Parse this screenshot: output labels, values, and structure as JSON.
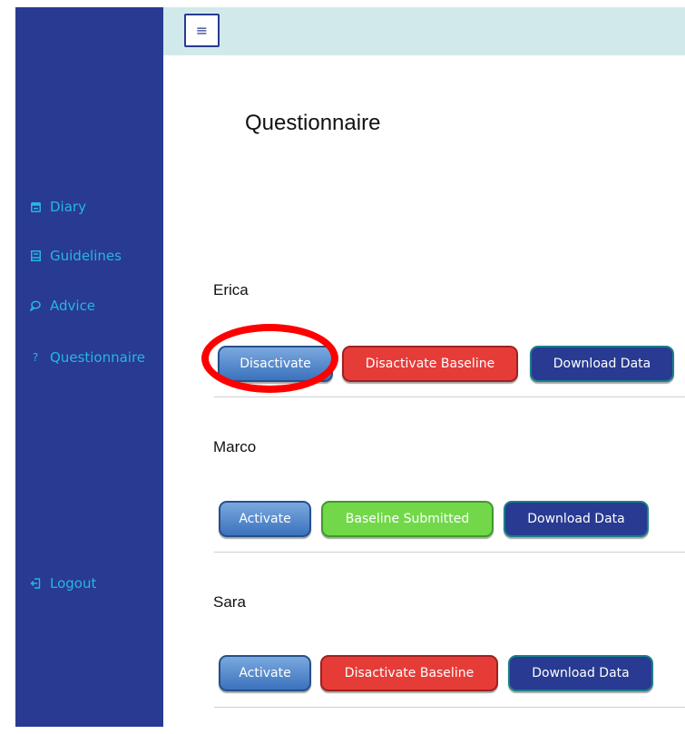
{
  "sidebar": {
    "items": [
      {
        "label": "Diary",
        "icon": "calendar-icon"
      },
      {
        "label": "Guidelines",
        "icon": "book-icon"
      },
      {
        "label": "Advice",
        "icon": "speech-bubble-icon"
      },
      {
        "label": "Questionnaire",
        "icon": "question-icon"
      }
    ],
    "logout": {
      "label": "Logout",
      "icon": "logout-icon"
    }
  },
  "header": {
    "menu_glyph": "≡"
  },
  "main": {
    "title": "Questionnaire",
    "users": [
      {
        "name": "Erica",
        "activate_label": "Disactivate",
        "baseline_label": "Disactivate Baseline",
        "baseline_status": "red",
        "download_label": "Download Data"
      },
      {
        "name": "Marco",
        "activate_label": "Activate",
        "baseline_label": "Baseline Submitted",
        "baseline_status": "green",
        "download_label": "Download Data"
      },
      {
        "name": "Sara",
        "activate_label": "Activate",
        "baseline_label": "Disactivate Baseline",
        "baseline_status": "red",
        "download_label": "Download Data"
      }
    ]
  },
  "colors": {
    "sidebar": "#283a91",
    "topbar": "#d2e9ec",
    "nav_text": "#25b6e6",
    "highlight": "#ff0000"
  }
}
